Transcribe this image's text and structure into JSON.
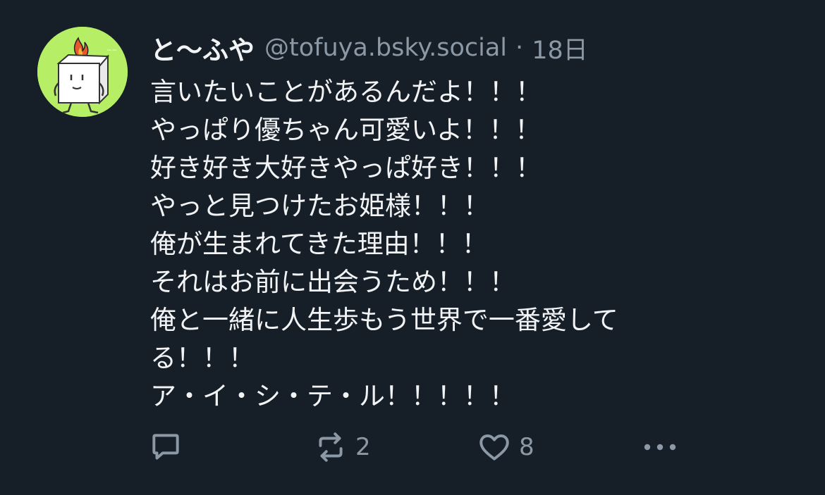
{
  "post": {
    "display_name": "と〜ふや",
    "handle": "@tofuya.bsky.social",
    "separator": "·",
    "time": "18日",
    "lines": [
      "言いたいことがあるんだよ！！！",
      "やっぱり優ちゃん可愛いよ！！！",
      "好き好き大好きやっぱ好き！！！",
      "やっと見つけたお姫様！！！",
      "俺が生まれてきた理由！！！",
      "それはお前に出会うため！！！",
      "俺と一緒に人生歩もう世界で一番愛して",
      "る！！！",
      "ア・イ・シ・テ・ル！！！！！"
    ]
  },
  "actions": {
    "reply": {
      "icon": "reply-icon"
    },
    "repost": {
      "icon": "repost-icon",
      "count": "2"
    },
    "like": {
      "icon": "heart-icon",
      "count": "8"
    },
    "more": {
      "icon": "more-icon"
    }
  },
  "colors": {
    "background": "#161e27",
    "text": "#f1f3f5",
    "muted": "#8b98a5",
    "avatar_bg": "#b6ef66"
  }
}
